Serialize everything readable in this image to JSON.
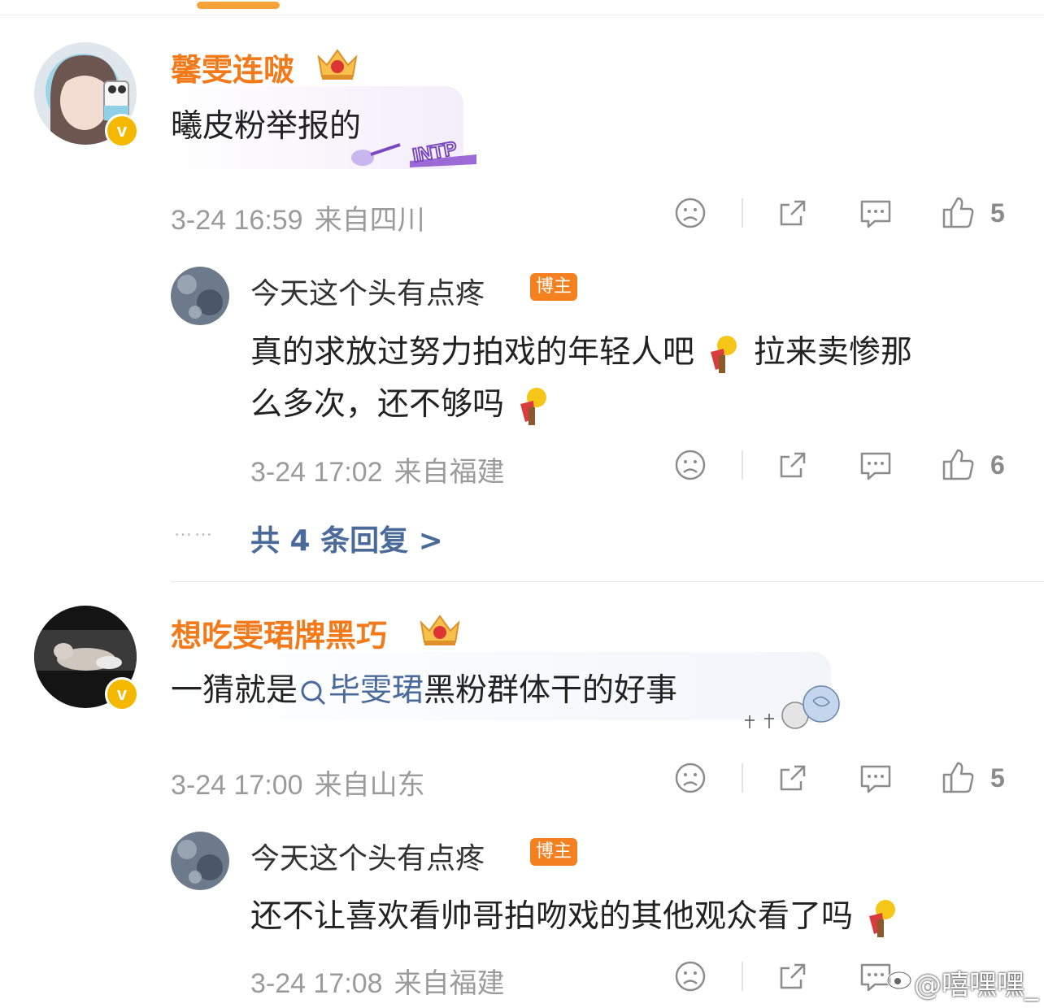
{
  "comments": [
    {
      "username": "馨雯连啵",
      "content": "曦皮粉举报的",
      "time": "3-24 16:59",
      "location": "来自四川",
      "likes": "5",
      "bubble_label": "INTP",
      "reply": {
        "username": "今天这个头有点疼",
        "tag": "博主",
        "content_line1": "真的求放过努力拍戏的年轻人吧",
        "content_line1b": "拉来卖惨那",
        "content_line2": "么多次，还不够吗",
        "time": "3-24 17:02",
        "location": "来自福建",
        "likes": "6"
      },
      "more_replies": "共 4 条回复 >"
    },
    {
      "username": "想吃雯珺牌黑巧",
      "content_prefix": "一猜就是",
      "topic": "毕雯珺",
      "content_suffix": "黑粉群体干的好事",
      "time": "3-24 17:00",
      "location": "来自山东",
      "likes": "5",
      "reply": {
        "username": "今天这个头有点疼",
        "tag": "博主",
        "content": "还不让喜欢看帅哥拍吻戏的其他观众看了吗",
        "time": "3-24 17:08",
        "location": "来自福建"
      }
    }
  ],
  "dots": "……",
  "watermark": "@嘻嘿嘿_",
  "colors": {
    "username": "#f27a1a",
    "tag": "#f5801f",
    "link": "#4a6a9a",
    "meta": "#9b9b9b",
    "vip": "#f5b800"
  },
  "icons": [
    "dislike-face-icon",
    "share-icon",
    "comment-icon",
    "like-thumb-icon"
  ]
}
